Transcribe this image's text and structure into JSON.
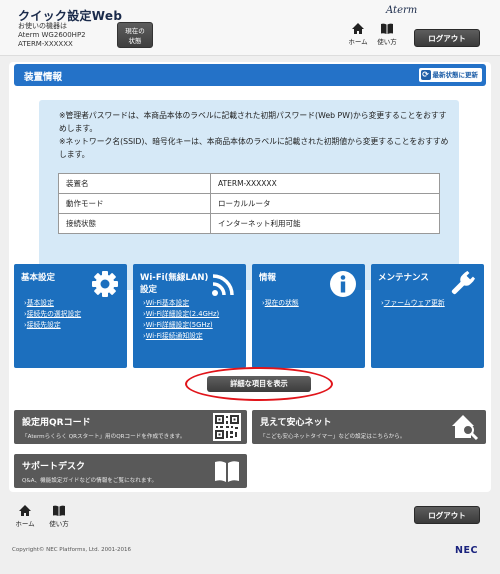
{
  "header": {
    "app_title": "クイック設定Web",
    "device_label": "お使いの機器は",
    "device_model": "Aterm WG2600HP2",
    "device_name": "ATERM-XXXXXX",
    "status_button": [
      "現在の",
      "状態"
    ],
    "brand": "Aterm",
    "home_label": "ホーム",
    "help_label": "使い方",
    "logout_label": "ログアウト"
  },
  "section": {
    "title": "装置情報",
    "refresh_label": "最新状態に更新"
  },
  "notes": [
    "※管理者パスワードは、本商品本体のラベルに記載された初期パスワード(Web PW)から変更することをおすすめします。",
    "※ネットワーク名(SSID)、暗号化キーは、本商品本体のラベルに記載された初期値から変更することをおすすめします。"
  ],
  "device_table": [
    {
      "key": "装置名",
      "value": "ATERM-XXXXXX"
    },
    {
      "key": "動作モード",
      "value": "ローカルルータ"
    },
    {
      "key": "接続状態",
      "value": "インターネット利用可能"
    }
  ],
  "tiles": [
    {
      "title_lines": [
        "基本設定"
      ],
      "icon": "gear-icon",
      "links": [
        "基本設定",
        "接続先の選択設定",
        "接続先設定"
      ]
    },
    {
      "title_lines": [
        "Wi-Fi(無線LAN)",
        "設定"
      ],
      "icon": "wifi-icon",
      "links": [
        "Wi-Fi基本設定",
        "Wi-Fi詳細設定(2.4GHz)",
        "Wi-Fi詳細設定(5GHz)",
        "Wi-Fi接続通知設定"
      ]
    },
    {
      "title_lines": [
        "情報"
      ],
      "icon": "info-icon",
      "links": [
        "現在の状態"
      ]
    },
    {
      "title_lines": [
        "メンテナンス"
      ],
      "icon": "wrench-icon",
      "links": [
        "ファームウェア更新"
      ]
    }
  ],
  "detail_button": "詳細な項目を表示",
  "promos": {
    "qr": {
      "title": "設定用QRコード",
      "sub": "「Atermらくらく QRスタート」用のQRコードを作成できます。"
    },
    "safe": {
      "title": "見えて安心ネット",
      "sub": "「こども安心ネットタイマー」などの設定はこちらから。"
    },
    "support": {
      "title": "サポートデスク",
      "sub": "Q&A、機能設定ガイドなどの情報をご覧になれます。"
    }
  },
  "footer": {
    "home_label": "ホーム",
    "help_label": "使い方",
    "logout_label": "ログアウト",
    "copyright": "Copyright© NEC Platforms, Ltd. 2001-2016",
    "nec_logo": "NEC"
  },
  "colors": {
    "primary_blue": "#1c6fbe",
    "section_blue": "#2472c8",
    "info_bg": "#d6e9f7",
    "highlight_red": "#e1141a"
  }
}
